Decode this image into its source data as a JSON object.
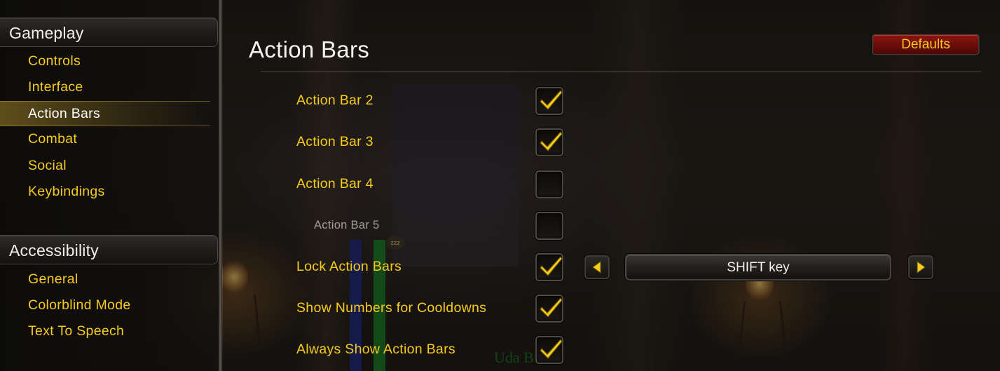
{
  "sidebar": {
    "sections": [
      {
        "title": "Gameplay",
        "items": [
          "Controls",
          "Interface",
          "Action Bars",
          "Combat",
          "Social",
          "Keybindings"
        ]
      },
      {
        "title": "Accessibility",
        "items": [
          "General",
          "Colorblind Mode",
          "Text To Speech"
        ]
      }
    ],
    "active_item": "Action Bars"
  },
  "main": {
    "title": "Action Bars",
    "defaults_label": "Defaults",
    "options": [
      {
        "label": "Action Bar 2",
        "checked": true,
        "enabled": true
      },
      {
        "label": "Action Bar 3",
        "checked": true,
        "enabled": true
      },
      {
        "label": "Action Bar 4",
        "checked": false,
        "enabled": true
      },
      {
        "label": "Action Bar 5",
        "checked": false,
        "enabled": false
      },
      {
        "label": "Lock Action Bars",
        "checked": true,
        "enabled": true
      },
      {
        "label": "Show Numbers for Cooldowns",
        "checked": true,
        "enabled": true
      },
      {
        "label": "Always Show Action Bars",
        "checked": true,
        "enabled": true
      }
    ],
    "lock_modifier": {
      "value": "SHIFT key"
    }
  },
  "background": {
    "nameplate_text": "Uda  Beast",
    "sleep_bubble": "zzz"
  },
  "colors": {
    "gold_text": "#f6cb1c",
    "defaults_red": "#8e1512",
    "check_gold": "#f6cb1c"
  }
}
